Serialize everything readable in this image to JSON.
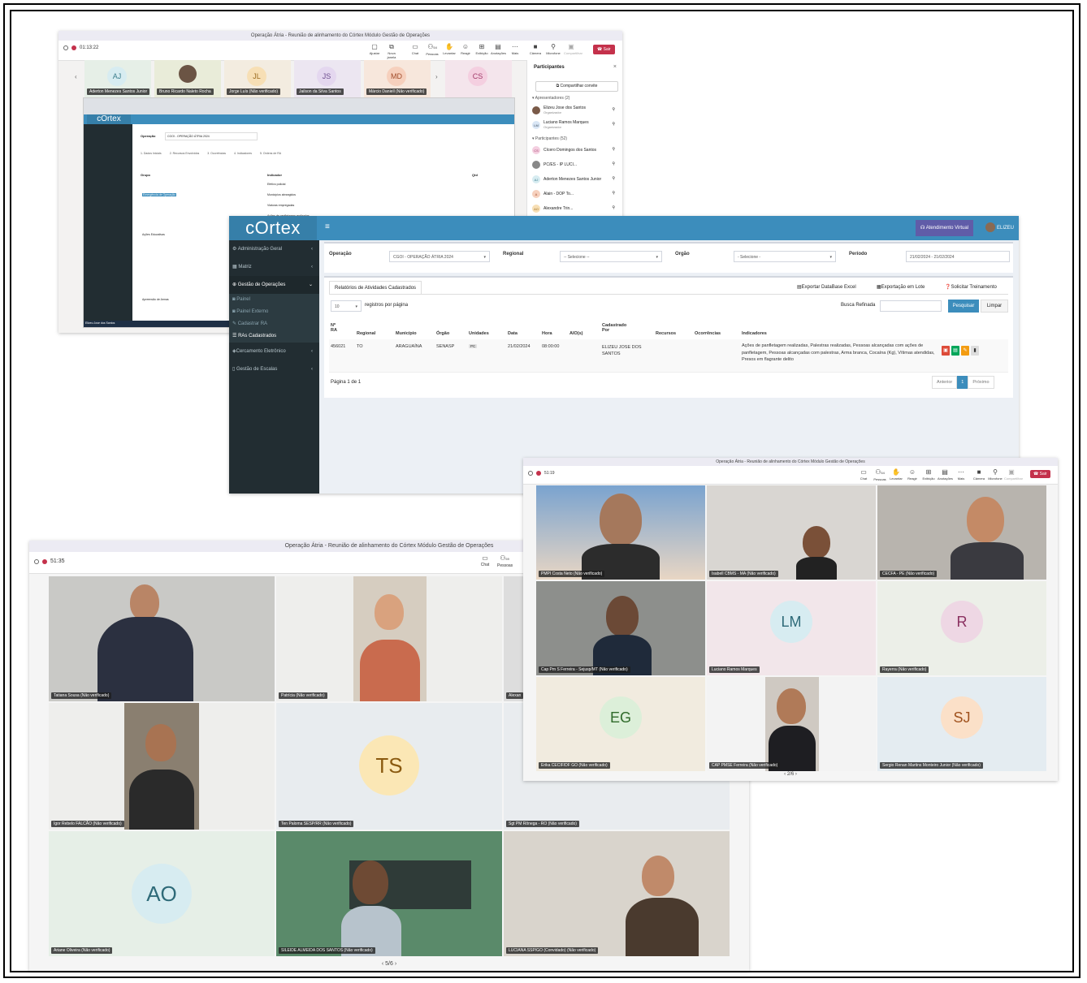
{
  "window_title": "Operação Átria - Reunião de alinhamento do Córtex Módulo Gestão de Operações",
  "screenshot1": {
    "timer": "01:13:22",
    "toolbar": [
      "Ajustar",
      "Nova janela",
      "Chat",
      "Pessoas",
      "Levantar",
      "Reagir",
      "Exibição",
      "Anotações",
      "Mais",
      "Câmera",
      "Microfone",
      "Compartilhar"
    ],
    "leave_label": "Sair",
    "people_count": "54",
    "strip": [
      {
        "initials": "AJ",
        "name": "Aderton Menezes Santos Junior"
      },
      {
        "initials": "",
        "name": "Bruno Ricardo Naleto Rocha"
      },
      {
        "initials": "JL",
        "name": "Jorge Luís (Não verificado)"
      },
      {
        "initials": "JS",
        "name": "Jailson da Silva Santos"
      },
      {
        "initials": "MD",
        "name": "Márcio Daniell (Não verificado)"
      },
      {
        "initials": "CS",
        "name": ""
      }
    ],
    "participants_title": "Participantes",
    "share_invite": "Compartilhar convite",
    "presenters_header": "Apresentadores (2)",
    "presenters": [
      {
        "name": "Elizeu Jose dos Santos",
        "role": "Organizador"
      },
      {
        "name": "Luciano Ramos Marques",
        "role": "Organizador",
        "initials": "LM"
      }
    ],
    "attendees_header": "Participantes (52)",
    "attendees": [
      {
        "initials": "CS",
        "name": "Cícero Domingos dos Santos"
      },
      {
        "initials": "",
        "name": "PC/ES - IP LUCI..."
      },
      {
        "initials": "AJ",
        "name": "Aderton Menezes Santos Junior"
      },
      {
        "initials": "A",
        "name": "Alain - DOP To..."
      },
      {
        "initials": "AO",
        "name": "Alexandre Trin..."
      }
    ],
    "taskbar_user": "Elizeu Jose dos Santos",
    "mini_cortex": {
      "logo": "cOrtex",
      "operacao_label": "Operação",
      "operacao_value": "CGOI - OPERAÇÃO ÁTRIA 2024",
      "tabs": [
        "1. Dados Iniciais",
        "2. Recursos Envolvidos",
        "3. Ocorrências",
        "4. Indicadores",
        "5. Ordens de RA"
      ],
      "grupo_label": "Grupo",
      "indicador_label": "Indicador",
      "qtd_label": "Qtd",
      "indicadores": [
        "Efetivo policial",
        "Municípios abrangidos",
        "Viaturas empregadas",
        "Ações de panfletagem realizadas"
      ],
      "row_labels": [
        "Emergência de Operação",
        "Ações Educativas",
        "Apreensão de Armas"
      ]
    }
  },
  "cortex": {
    "logo": "cOrtex",
    "virtual_label": "Atendimento Virtual",
    "user": "ELIZEU",
    "sidebar": [
      {
        "label": "Administração Geral"
      },
      {
        "label": "Matriz"
      },
      {
        "label": "Gestão de Operações"
      }
    ],
    "sidebar_sub": [
      "Painel",
      "Painel Externo",
      "Cadastrar RA",
      "RAs Cadastrados"
    ],
    "sidebar_more": [
      "Cercamento Eletrônico",
      "Gestão de Escalas"
    ],
    "filters": {
      "operacao_label": "Operação",
      "operacao_value": "CGOI - OPERAÇÃO ÁTRIA 2024",
      "regional_label": "Regional",
      "regional_value": "-- Selecione --",
      "orgao_label": "Orgão",
      "orgao_value": "- Selecione -",
      "periodo_label": "Período",
      "periodo_value": "21/02/2024 - 21/02/2024"
    },
    "tab": "Relatórios de Atividades Cadastrados",
    "export_excel": "Exportar DataBase Excel",
    "export_lote": "Exportação em Lote",
    "solicitar": "Solicitar Treinamento",
    "page_size": "10",
    "per_page_label": "registros por página",
    "busca_label": "Busca Refinada",
    "pesquisar": "Pesquisar",
    "limpar": "Limpar",
    "columns": [
      "Nº RA",
      "Regional",
      "Município",
      "Órgão",
      "Unidades",
      "Data",
      "Hora",
      "AIO(s)",
      "Cadastrado Por",
      "Recursos",
      "Ocorrências",
      "Indicadores"
    ],
    "row": {
      "ra": "456021",
      "regional": "TO",
      "municipio": "ARAGUAÍNA",
      "orgao": "SENASP",
      "unidade": "PC",
      "data": "21/02/2024",
      "hora": "08:00:00",
      "aio": "",
      "cadastrado_por": "ELIZEU JOSE DOS SANTOS",
      "recursos": "",
      "ocorrencias": "",
      "indicadores": "Ações de panfletagem realizadas, Palestras realizadas, Pessoas alcançadas com ações de panfletagem, Pessoas alcançadas com palestras, Arma branca, Cocaína (Kg), Vítimas atendidas, Presos em flagrante delito"
    },
    "page_info": "Página 1 de 1",
    "anterior": "Anterior",
    "page_num": "1",
    "proximo": "Próximo"
  },
  "screenshot3": {
    "timer": "51:19",
    "toolbar": [
      "Chat",
      "Pessoas",
      "Levantar",
      "Reagir",
      "Exibição",
      "Anotações",
      "Mais",
      "Câmera",
      "Microfone",
      "Compartilhar"
    ],
    "leave_label": "Sair",
    "people_count": "54",
    "tiles": [
      {
        "name": "PMPI Costa Neto (Não verificado)",
        "initials": ""
      },
      {
        "name": "Isabell CBMS - MA (Não verificado)",
        "initials": ""
      },
      {
        "name": "CECFA - PE (Não verificado)",
        "initials": ""
      },
      {
        "name": "Cap Pm S Ferreira - Sejusp/MT (Não verificado)",
        "initials": ""
      },
      {
        "name": "Luciano Ramos Marques",
        "initials": "LM"
      },
      {
        "name": "Rayerra (Não verificado)",
        "initials": "R"
      },
      {
        "name": "Erika CECIF/DF GO (Não verificado)",
        "initials": "EG"
      },
      {
        "name": "CAP PMSE Ferreira (Não verificado)",
        "initials": ""
      },
      {
        "name": "Sergio Renan Martins Monteiro Junior (Não verificado)",
        "initials": "SJ"
      }
    ],
    "pager": "2/6"
  },
  "screenshot4": {
    "timer": "51:35",
    "toolbar": [
      "Chat",
      "Pessoas"
    ],
    "people_count": "59",
    "tiles": [
      {
        "name": "Tatiana Sousa (Não verificado)",
        "initials": ""
      },
      {
        "name": "Patrícia (Não verificado)",
        "initials": ""
      },
      {
        "name": "Alexan",
        "initials": ""
      },
      {
        "name": "Igor Rebelo FALCÃO (Não verificado)",
        "initials": ""
      },
      {
        "name": "Ten Paloma SESP/RR (Não verificado)",
        "initials": "TS"
      },
      {
        "name": "Sgt PM Rônega - RO (Não verificado)",
        "initials": ""
      },
      {
        "name": "Ariane Oliveira (Não verificado)",
        "initials": "AO"
      },
      {
        "name": "SILEIDE ALMEIDA DOS SANTOS (Não verificado)",
        "initials": ""
      },
      {
        "name": "LUCIANA SSP/GO (Convidado) (Não verificado)",
        "initials": ""
      }
    ],
    "pager": "5/6"
  }
}
